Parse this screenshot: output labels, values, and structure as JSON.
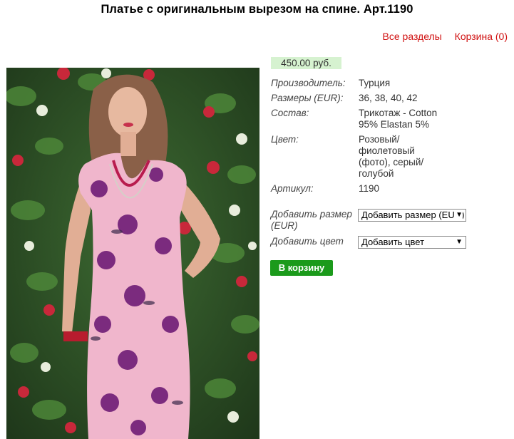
{
  "page": {
    "title": "Платье с оригинальным вырезом на спине. Арт.1190"
  },
  "nav": {
    "all_sections": "Все разделы",
    "cart": "Корзина (0)"
  },
  "product": {
    "price": "450.00 руб.",
    "props": [
      {
        "key": "Производитель:",
        "value": "Турция"
      },
      {
        "key": "Размеры (EUR):",
        "value": "36, 38, 40, 42"
      },
      {
        "key": "Состав:",
        "value": "Трикотаж - Cotton 95% Elastan 5%"
      },
      {
        "key": "Цвет:",
        "value": "Розовый/ фиолетовый (фото), серый/ голубой"
      },
      {
        "key": "Артикул:",
        "value": "1190"
      }
    ],
    "add_size_label": "Добавить размер (EUR)",
    "add_size_select": "Добавить размер (EUR)",
    "add_color_label": "Добавить цвет",
    "add_color_select": "Добавить цвет",
    "buy_button": "В корзину"
  },
  "colors": {
    "link": "#d01010",
    "price_bg": "#d6f2d0",
    "buy_bg": "#1b9a1b"
  },
  "icons": {
    "select_arrow": "chevron-down-icon"
  }
}
